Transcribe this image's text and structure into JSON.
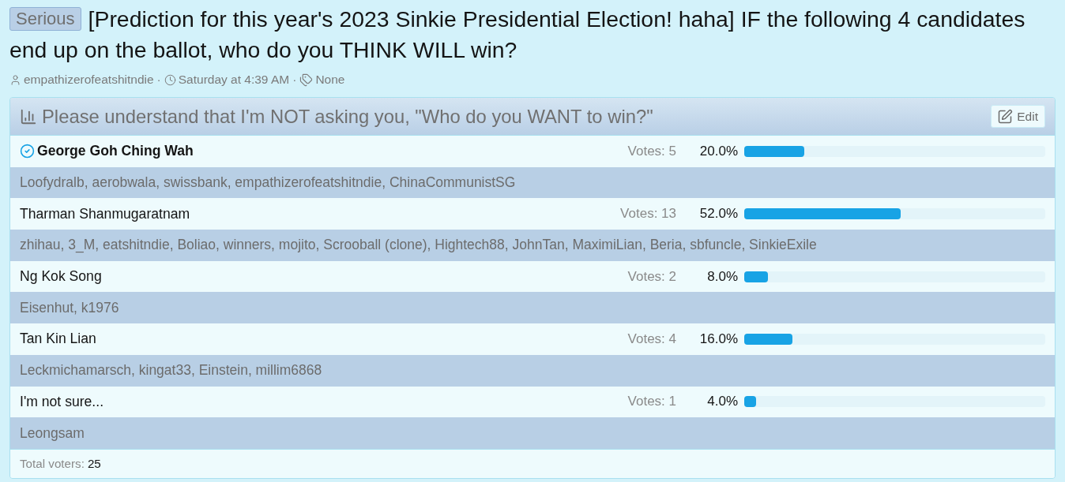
{
  "thread": {
    "prefix": "Serious",
    "title": "[Prediction for this year's 2023 Sinkie Presidential Election! haha] IF the following 4 candidates end up on the ballot, who do you THINK WILL win?"
  },
  "meta": [
    {
      "kind": "author",
      "text": "empathizerofeatshitndie"
    },
    {
      "kind": "separator",
      "text": "·"
    },
    {
      "kind": "date",
      "text": "Saturday at 4:39 AM"
    },
    {
      "kind": "separator",
      "text": "·"
    },
    {
      "kind": "tags",
      "text": "None"
    }
  ],
  "poll": {
    "question": "Please understand that I'm NOT asking you, \"Who do you WANT to win?\"",
    "edit_button": "Edit",
    "options": [
      {
        "name": "George Goh Ching Wah",
        "selected": true,
        "votes": "Votes: 5",
        "percent": "20.0%",
        "level": 0.2,
        "voters": "Loofydralb, aerobwala, swissbank, empathizerofeatshitndie, ChinaCommunistSG"
      },
      {
        "name": "Tharman Shanmugaratnam",
        "selected": false,
        "votes": "Votes: 13",
        "percent": "52.0%",
        "level": 0.52,
        "voters": "zhihau, 3_M, eatshitndie, Boliao, winners, mojito, Scrooball (clone), Hightech88, JohnTan, MaximiLian, Beria, sbfuncle, SinkieExile"
      },
      {
        "name": "Ng Kok Song",
        "selected": false,
        "votes": "Votes: 2",
        "percent": "8.0%",
        "level": 0.08,
        "voters": "Eisenhut, k1976"
      },
      {
        "name": "Tan Kin Lian",
        "selected": false,
        "votes": "Votes: 4",
        "percent": "16.0%",
        "level": 0.16,
        "voters": "Leckmichamarsch, kingat33, Einstein, millim6868"
      },
      {
        "name": "I'm not sure...",
        "selected": false,
        "votes": "Votes: 1",
        "percent": "4.0%",
        "level": 0.04,
        "voters": "Leongsam"
      }
    ],
    "total_label": "Total voters:",
    "total_value": "25"
  }
}
